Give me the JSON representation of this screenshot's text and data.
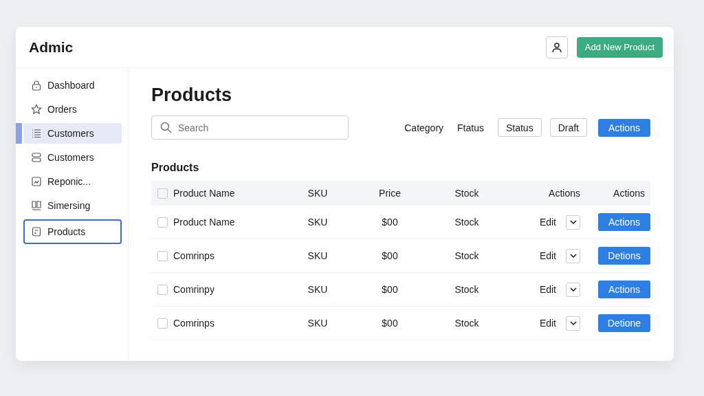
{
  "app": {
    "title": "Admic"
  },
  "header": {
    "primary_button": "Add New Product"
  },
  "sidebar": {
    "items": [
      {
        "label": "Dashboard",
        "selected": false,
        "focused": false
      },
      {
        "label": "Orders",
        "selected": false,
        "focused": false
      },
      {
        "label": "Customers",
        "selected": true,
        "focused": false
      },
      {
        "label": "Customers",
        "selected": false,
        "focused": false
      },
      {
        "label": "Reponic...",
        "selected": false,
        "focused": false
      },
      {
        "label": "Simersing",
        "selected": false,
        "focused": false
      },
      {
        "label": "Products",
        "selected": false,
        "focused": true
      }
    ]
  },
  "page": {
    "title": "Products"
  },
  "search": {
    "placeholder": "Search"
  },
  "filters": [
    {
      "label": "Category",
      "kind": "text"
    },
    {
      "label": "Ftatus",
      "kind": "text"
    },
    {
      "label": "Status",
      "kind": "outline"
    },
    {
      "label": "Draft",
      "kind": "outline"
    },
    {
      "label": "Actions",
      "kind": "primary"
    }
  ],
  "section": {
    "title": "Products"
  },
  "table": {
    "header_checked": false,
    "columns": [
      "Product Name",
      "SKU",
      "Price",
      "Stock",
      "Actions",
      "Actions"
    ],
    "rows": [
      {
        "checked": false,
        "name": "Product Name",
        "sku": "SKU",
        "price": "$00",
        "stock": "Stock",
        "edit": "Edit",
        "action": "Actions"
      },
      {
        "checked": false,
        "name": "Comrinps",
        "sku": "SKU",
        "price": "$00",
        "stock": "Stock",
        "edit": "Edit",
        "action": "Detions"
      },
      {
        "checked": false,
        "name": "Comrinpy",
        "sku": "SKU",
        "price": "$00",
        "stock": "Stock",
        "edit": "Edit",
        "action": "Actions"
      },
      {
        "checked": false,
        "name": "Comrinps",
        "sku": "SKU",
        "price": "$00",
        "stock": "Stock",
        "edit": "Edit",
        "action": "Detione"
      }
    ]
  }
}
